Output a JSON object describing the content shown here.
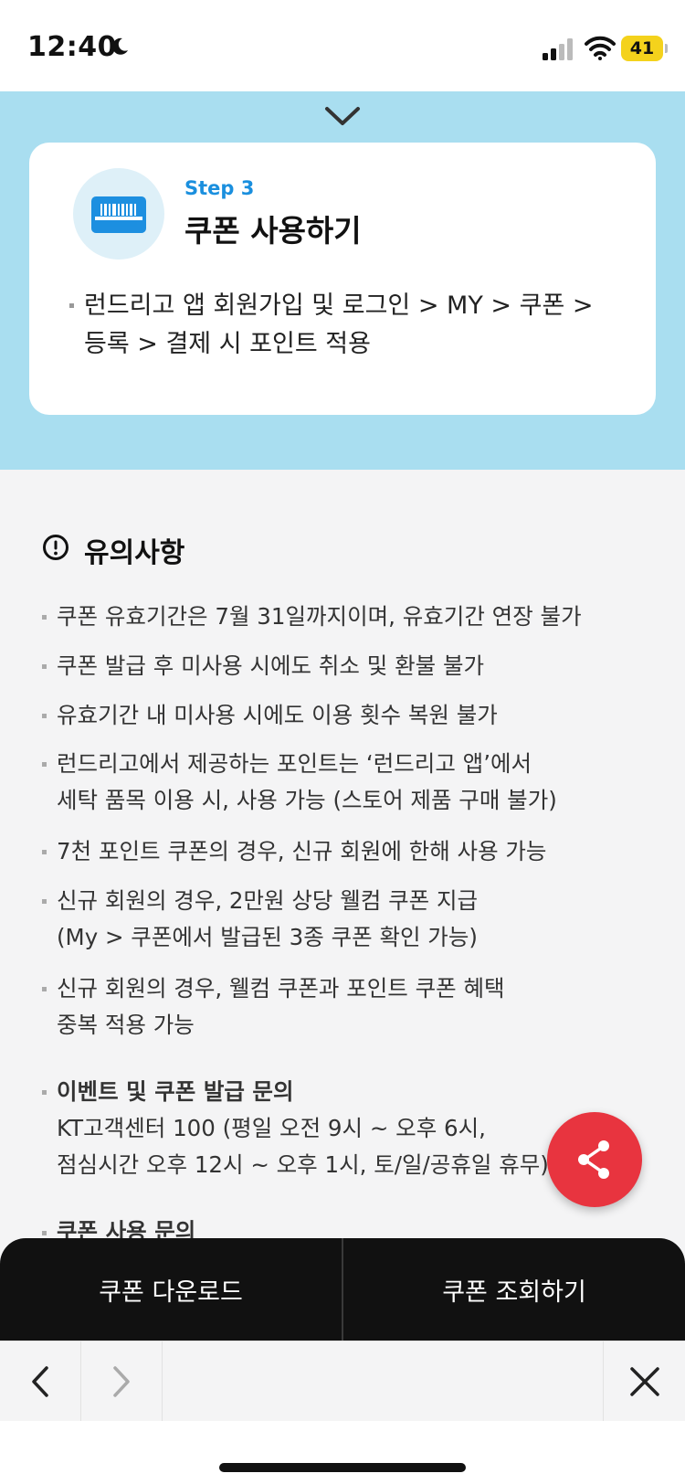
{
  "status_bar": {
    "time": "12:40",
    "battery": "41"
  },
  "step": {
    "label": "Step 3",
    "title": "쿠폰 사용하기",
    "desc_line1": "런드리고 앱 회원가입 및 로그인 > MY > 쿠폰 >",
    "desc_line2": "등록 > 결제 시 포인트 적용"
  },
  "notes": {
    "title": "유의사항",
    "items": [
      {
        "lines": [
          "쿠폰 유효기간은 7월 31일까지이며, 유효기간 연장 불가"
        ]
      },
      {
        "lines": [
          "쿠폰 발급 후 미사용 시에도 취소 및 환불 불가"
        ]
      },
      {
        "lines": [
          "유효기간 내 미사용 시에도 이용 횟수 복원 불가"
        ]
      },
      {
        "lines": [
          "런드리고에서 제공하는 포인트는 ‘런드리고 앱’에서",
          "세탁 품목 이용 시, 사용 가능 (스토어 제품 구매 불가)"
        ]
      },
      {
        "lines": [
          "7천 포인트 쿠폰의 경우, 신규 회원에 한해 사용 가능"
        ]
      },
      {
        "lines": [
          "신규 회원의 경우, 2만원 상당 웰컴 쿠폰 지급",
          "(My > 쿠폰에서 발급된 3종 쿠폰 확인 가능)"
        ]
      },
      {
        "lines": [
          "신규 회원의 경우, 웰컴 쿠폰과 포인트 쿠폰 혜택",
          "중복 적용 가능"
        ]
      }
    ],
    "inquiry": {
      "title": "이벤트 및 쿠폰 발급 문의",
      "line1": "KT고객센터 100 (평일 오전 9시 ~ 오후 6시,",
      "line2": "점심시간 오후 12시 ~ 오후 1시, 토/일/공휴일 휴무)"
    },
    "usage_inquiry_title": "쿠폰 사용 문의"
  },
  "actions": {
    "download": "쿠폰 다운로드",
    "lookup": "쿠폰 조회하기"
  },
  "colors": {
    "step_bg": "#a9def0",
    "accent_blue": "#1a8fde",
    "share_red": "#e8343f",
    "action_bar": "#111111"
  },
  "icons": [
    "moon-icon",
    "signal-icon",
    "wifi-icon",
    "chevron-down-icon",
    "barcode-icon",
    "alert-icon",
    "share-icon",
    "back-arrow-icon",
    "forward-arrow-icon",
    "close-icon"
  ]
}
